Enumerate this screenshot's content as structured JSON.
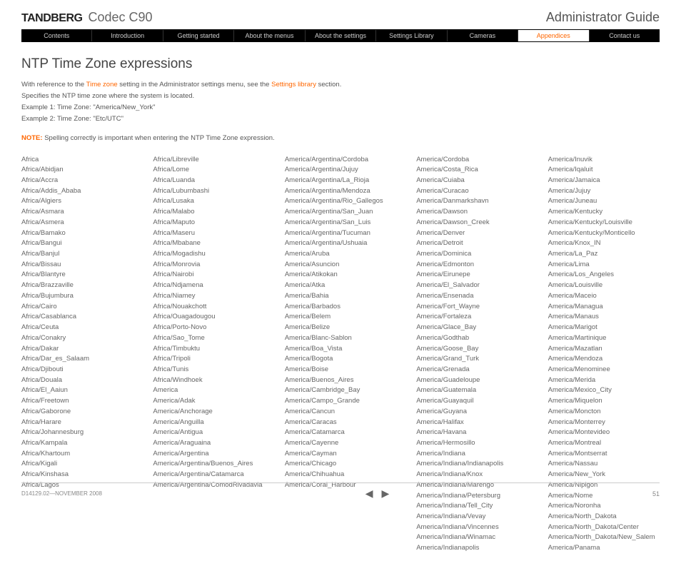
{
  "header": {
    "brand": "TANDBERG",
    "model": "Codec C90",
    "guide": "Administrator Guide"
  },
  "nav": {
    "items": [
      "Contents",
      "Introduction",
      "Getting started",
      "About the menus",
      "About the settings",
      "Settings Library",
      "Cameras",
      "Appendices",
      "Contact us"
    ],
    "active_index": 7
  },
  "page": {
    "title": "NTP Time Zone expressions",
    "intro_pre": "With reference to the ",
    "intro_link1": "Time zone",
    "intro_mid": " setting in the Administrator settings menu, see the ",
    "intro_link2": "Settings library",
    "intro_post": " section.",
    "spec": "Specifies the NTP time zone where the system is located.",
    "ex1": "Example 1: Time Zone: \"America/New_York\"",
    "ex2": "Example 2: Time Zone: \"Etc/UTC\"",
    "note_label": "NOTE:",
    "note_text": " Spelling correctly is important when entering the NTP Time Zone expression."
  },
  "columns": [
    [
      "Africa",
      "Africa/Abidjan",
      "Africa/Accra",
      "Africa/Addis_Ababa",
      "Africa/Algiers",
      "Africa/Asmara",
      "Africa/Asmera",
      "Africa/Bamako",
      "Africa/Bangui",
      "Africa/Banjul",
      "Africa/Bissau",
      "Africa/Blantyre",
      "Africa/Brazzaville",
      "Africa/Bujumbura",
      "Africa/Cairo",
      "Africa/Casablanca",
      "Africa/Ceuta",
      "Africa/Conakry",
      "Africa/Dakar",
      "Africa/Dar_es_Salaam",
      "Africa/Djibouti",
      "Africa/Douala",
      "Africa/El_Aaiun",
      "Africa/Freetown",
      "Africa/Gaborone",
      "Africa/Harare",
      "Africa/Johannesburg",
      "Africa/Kampala",
      "Africa/Khartoum",
      "Africa/Kigali",
      "Africa/Kinshasa",
      "Africa/Lagos"
    ],
    [
      "Africa/Libreville",
      "Africa/Lome",
      "Africa/Luanda",
      "Africa/Lubumbashi",
      "Africa/Lusaka",
      "Africa/Malabo",
      "Africa/Maputo",
      "Africa/Maseru",
      "Africa/Mbabane",
      "Africa/Mogadishu",
      "Africa/Monrovia",
      "Africa/Nairobi",
      "Africa/Ndjamena",
      "Africa/Niamey",
      "Africa/Nouakchott",
      "Africa/Ouagadougou",
      "Africa/Porto-Novo",
      "Africa/Sao_Tome",
      "Africa/Timbuktu",
      "Africa/Tripoli",
      "Africa/Tunis",
      "Africa/Windhoek",
      "America",
      "America/Adak",
      "America/Anchorage",
      "America/Anguilla",
      "America/Antigua",
      "America/Araguaina",
      "America/Argentina",
      "America/Argentina/Buenos_Aires",
      "America/Argentina/Catamarca",
      "America/Argentina/ComodRivadavia"
    ],
    [
      "America/Argentina/Cordoba",
      "America/Argentina/Jujuy",
      "America/Argentina/La_Rioja",
      "America/Argentina/Mendoza",
      "America/Argentina/Rio_Gallegos",
      "America/Argentina/San_Juan",
      "America/Argentina/San_Luis",
      "America/Argentina/Tucuman",
      "America/Argentina/Ushuaia",
      "America/Aruba",
      "America/Asuncion",
      "America/Atikokan",
      "America/Atka",
      "America/Bahia",
      "America/Barbados",
      "America/Belem",
      "America/Belize",
      "America/Blanc-Sablon",
      "America/Boa_Vista",
      "America/Bogota",
      "America/Boise",
      "America/Buenos_Aires",
      "America/Cambridge_Bay",
      "America/Campo_Grande",
      "America/Cancun",
      "America/Caracas",
      "America/Catamarca",
      "America/Cayenne",
      "America/Cayman",
      "America/Chicago",
      "America/Chihuahua",
      "America/Coral_Harbour"
    ],
    [
      "America/Cordoba",
      "America/Costa_Rica",
      "America/Cuiaba",
      "America/Curacao",
      "America/Danmarkshavn",
      "America/Dawson",
      "America/Dawson_Creek",
      "America/Denver",
      "America/Detroit",
      "America/Dominica",
      "America/Edmonton",
      "America/Eirunepe",
      "America/El_Salvador",
      "America/Ensenada",
      "America/Fort_Wayne",
      "America/Fortaleza",
      "America/Glace_Bay",
      "America/Godthab",
      "America/Goose_Bay",
      "America/Grand_Turk",
      "America/Grenada",
      "America/Guadeloupe",
      "America/Guatemala",
      "America/Guayaquil",
      "America/Guyana",
      "America/Halifax",
      "America/Havana",
      "America/Hermosillo",
      "America/Indiana",
      "America/Indiana/Indianapolis",
      "America/Indiana/Knox",
      "America/Indiana/Marengo",
      "America/Indiana/Petersburg",
      "America/Indiana/Tell_City",
      "America/Indiana/Vevay",
      "America/Indiana/Vincennes",
      "America/Indiana/Winamac",
      "America/Indianapolis"
    ],
    [
      "America/Inuvik",
      "America/Iqaluit",
      "America/Jamaica",
      "America/Jujuy",
      "America/Juneau",
      "America/Kentucky",
      "America/Kentucky/Louisville",
      "America/Kentucky/Monticello",
      "America/Knox_IN",
      "America/La_Paz",
      "America/Lima",
      "America/Los_Angeles",
      "America/Louisville",
      "America/Maceio",
      "America/Managua",
      "America/Manaus",
      "America/Marigot",
      "America/Martinique",
      "America/Mazatlan",
      "America/Mendoza",
      "America/Menominee",
      "America/Merida",
      "America/Mexico_City",
      "America/Miquelon",
      "America/Moncton",
      "America/Monterrey",
      "America/Montevideo",
      "America/Montreal",
      "America/Montserrat",
      "America/Nassau",
      "America/New_York",
      "America/Nipigon",
      "America/Nome",
      "America/Noronha",
      "America/North_Dakota",
      "America/North_Dakota/Center",
      "America/North_Dakota/New_Salem",
      "America/Panama"
    ]
  ],
  "footer": {
    "docinfo": "D14129.02—NOVEMBER 2008",
    "page": "51"
  }
}
